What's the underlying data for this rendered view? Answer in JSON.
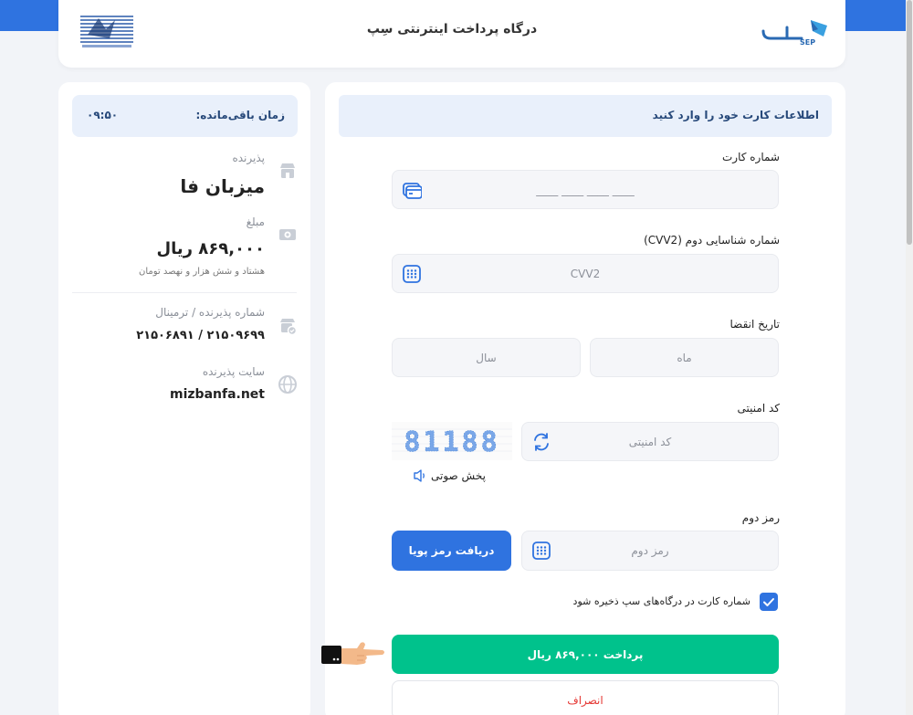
{
  "header": {
    "title": "درگاه پرداخت اینترنتی سِپ",
    "logo_text": "SEP"
  },
  "info": {
    "timer_label": "زمان باقی‌مانده:",
    "timer_value": "۰۹:۵۰",
    "merchant_label": "پذیرنده",
    "merchant_value": "میزبان فا",
    "amount_label": "مبلغ",
    "amount_value": "۸۶۹,۰۰۰ ریال",
    "amount_words": "هشتاد و شش هزار و نهصد تومان",
    "terminal_label": "شماره پذیرنده / ترمینال",
    "terminal_value": "۲۱۵۰۹۶۹۹ / ۲۱۵۰۶۸۹۱",
    "site_label": "سایت پذیرنده",
    "site_value": "mizbanfa.net"
  },
  "form": {
    "header": "اطلاعات کارت خود را وارد کنید",
    "card_label": "شماره کارت",
    "card_placeholder": "____ ____ ____ ____",
    "cvv_label": "شماره شناسایی دوم (CVV2)",
    "cvv_placeholder": "CVV2",
    "expiry_label": "تاریخ انقضا",
    "month_placeholder": "ماه",
    "year_placeholder": "سال",
    "captcha_label": "کد امنیتی",
    "captcha_placeholder": "کد امنیتی",
    "captcha_code": "81188",
    "audio_label": "پخش صوتی",
    "pin_label": "رمز دوم",
    "pin_placeholder": "رمز دوم",
    "otp_button": "دریافت رمز پویا",
    "save_card_label": "شماره کارت در درگاه‌های سپ ذخیره شود",
    "pay_button": "پرداخت ۸۶۹,۰۰۰ ریال",
    "cancel_button": "انصراف"
  },
  "colors": {
    "primary": "#2f73e0",
    "success": "#00c28c",
    "danger": "#e53935",
    "panel_bg": "#e9f0fb"
  }
}
